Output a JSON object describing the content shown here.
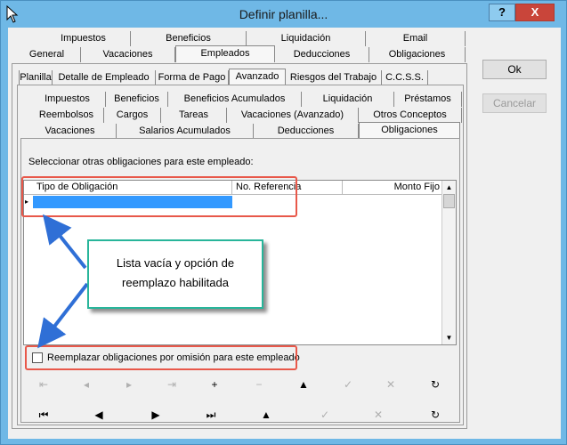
{
  "window": {
    "title": "Definir planilla..."
  },
  "titlebar": {
    "help_label": "?",
    "close_label": "X"
  },
  "tabs_top": {
    "row1": [
      "Impuestos",
      "Beneficios",
      "Liquidación",
      "Email"
    ],
    "row2": [
      "General",
      "Vacaciones",
      "Empleados",
      "Deducciones",
      "Obligaciones"
    ],
    "selected": "Empleados"
  },
  "tabs_mid": {
    "row": [
      "Planilla",
      "Detalle de Empleado",
      "Forma de Pago",
      "Avanzado",
      "Riesgos del Trabajo",
      "C.C.S.S."
    ],
    "selected": "Avanzado"
  },
  "tabs_inner": {
    "row1": [
      "Impuestos",
      "Beneficios",
      "Beneficios Acumulados",
      "Liquidación",
      "Préstamos"
    ],
    "row2": [
      "Reembolsos",
      "Cargos",
      "Tareas",
      "Vacaciones (Avanzado)",
      "Otros Conceptos"
    ],
    "row3": [
      "Vacaciones",
      "Salarios Acumulados",
      "Deducciones",
      "Obligaciones"
    ],
    "selected": "Obligaciones"
  },
  "content": {
    "instruction": "Seleccionar otras obligaciones para este empleado:",
    "columns": [
      "Tipo de Obligación",
      "No. Referencia",
      "Monto Fijo"
    ],
    "checkbox_label": "Reemplazar obligaciones por omisión para este empleado",
    "checkbox_checked": false
  },
  "callout": {
    "text": "Lista vacía y opción de reemplazo habilitada"
  },
  "buttons": {
    "ok": "Ok",
    "cancel": "Cancelar"
  },
  "nav_inner": [
    {
      "icon": "first-icon",
      "glyph": "⇤",
      "enabled": false
    },
    {
      "icon": "prev-icon",
      "glyph": "◂",
      "enabled": false
    },
    {
      "icon": "next-icon",
      "glyph": "▸",
      "enabled": false
    },
    {
      "icon": "last-icon",
      "glyph": "⇥",
      "enabled": false
    },
    {
      "icon": "add-icon",
      "glyph": "+",
      "enabled": true
    },
    {
      "icon": "delete-icon",
      "glyph": "−",
      "enabled": false
    },
    {
      "icon": "edit-icon",
      "glyph": "▲",
      "enabled": true
    },
    {
      "icon": "confirm-icon",
      "glyph": "✓",
      "enabled": false
    },
    {
      "icon": "cancel-icon",
      "glyph": "✕",
      "enabled": false
    },
    {
      "icon": "refresh-icon",
      "glyph": "↻",
      "enabled": true
    }
  ],
  "nav_outer": [
    {
      "icon": "first-icon",
      "glyph": "⏮",
      "enabled": true
    },
    {
      "icon": "prev-icon",
      "glyph": "◀",
      "enabled": true
    },
    {
      "icon": "next-icon",
      "glyph": "▶",
      "enabled": true
    },
    {
      "icon": "last-icon",
      "glyph": "⏭",
      "enabled": true
    },
    {
      "icon": "edit-icon",
      "glyph": "▲",
      "enabled": true
    },
    {
      "icon": "confirm-icon",
      "glyph": "✓",
      "enabled": false
    },
    {
      "icon": "cancel-icon",
      "glyph": "✕",
      "enabled": false
    },
    {
      "icon": "refresh-icon",
      "glyph": "↻",
      "enabled": true
    }
  ],
  "colors": {
    "title_bar": "#6fb8e6",
    "highlight": "#3399ff",
    "annotation_red": "#e8584a",
    "annotation_teal": "#28b59a",
    "arrow_blue": "#2f6fd6"
  }
}
